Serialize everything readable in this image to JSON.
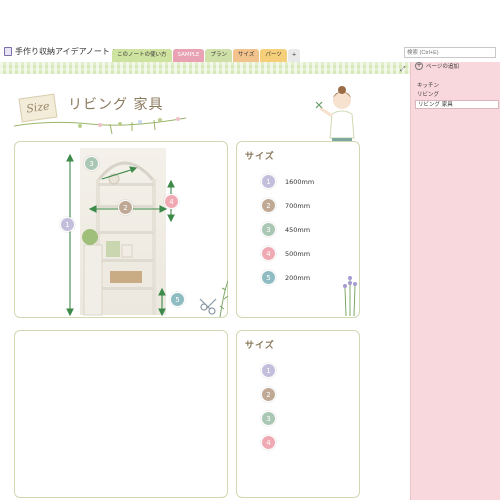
{
  "header": {
    "notebook_title": "手作り収納アイデアノート",
    "tabs": [
      {
        "label": "このノートの使い方",
        "color": "#cfe3a0"
      },
      {
        "label": "SAMPLE",
        "color": "#e8a2b4"
      },
      {
        "label": "プラン",
        "color": "#cfe1a8"
      },
      {
        "label": "サイズ",
        "color": "#f2c38d"
      },
      {
        "label": "パーツ",
        "color": "#f6cf7a"
      },
      {
        "label": "+",
        "color": "#e9e9e9"
      }
    ],
    "search_placeholder": "検索 (Ctrl+E)"
  },
  "page": {
    "title": "リビング 家具",
    "sign_text": "Size",
    "size_heading": "サイズ",
    "sizes": [
      {
        "num": "1",
        "value": "1600mm",
        "color": "#c3bedb"
      },
      {
        "num": "2",
        "value": "700mm",
        "color": "#bfa894"
      },
      {
        "num": "3",
        "value": "450mm",
        "color": "#a9c7b3"
      },
      {
        "num": "4",
        "value": "500mm",
        "color": "#f0a9b2"
      },
      {
        "num": "5",
        "value": "200mm",
        "color": "#8fbcc2"
      }
    ],
    "second_size_heading": "サイズ",
    "second_badges": [
      "1",
      "2",
      "3",
      "4"
    ]
  },
  "sidebar": {
    "add_page": "ページの追加",
    "pages": [
      {
        "label": "キッチン",
        "selected": false
      },
      {
        "label": "リビング",
        "selected": false
      },
      {
        "label": "リビング 家具",
        "selected": true
      }
    ]
  },
  "colors": {
    "accent_green": "#cfd9b3",
    "sidebar_pink": "#f9d8dd",
    "arrow_green": "#3d8a4a"
  }
}
